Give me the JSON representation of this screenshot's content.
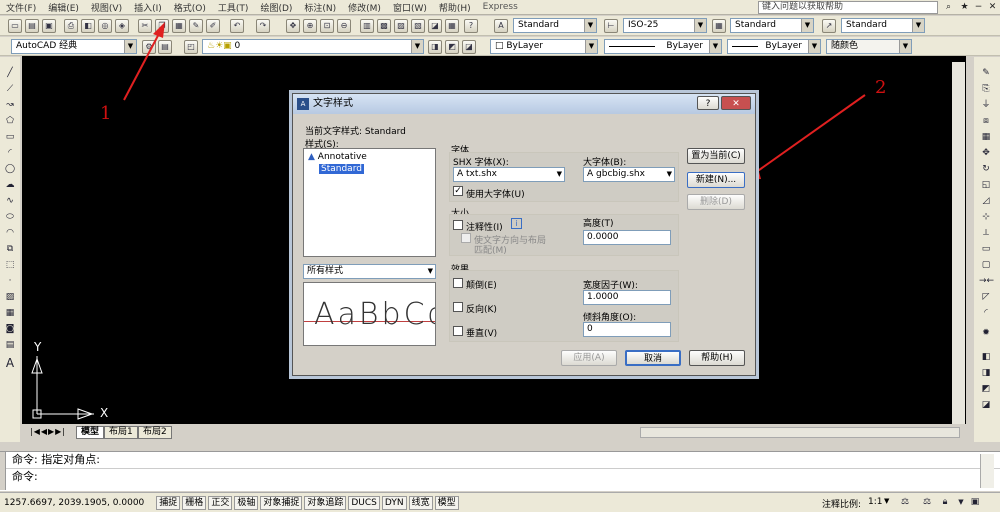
{
  "menu": [
    "文件(F)",
    "编辑(E)",
    "视图(V)",
    "插入(I)",
    "格式(O)",
    "工具(T)",
    "绘图(D)",
    "标注(N)",
    "修改(M)",
    "窗口(W)",
    "帮助(H)",
    "Express"
  ],
  "help_search": {
    "placeholder": "键入问题以获取帮助"
  },
  "toolbar2": {
    "text_style": "Standard",
    "dim_style": "ISO-25",
    "table_style": "Standard",
    "mleader_style": "Standard"
  },
  "toolbar3": {
    "workspace": "AutoCAD 经典",
    "layer": "0",
    "color": "ByLayer",
    "linetype": "ByLayer",
    "lineweight": "ByLayer",
    "plotstyle": "随颜色"
  },
  "annotations": {
    "arrow1": "1",
    "arrow2": "2"
  },
  "ucs": {
    "y": "Y",
    "x": "X"
  },
  "layout_tabs": [
    "模型",
    "布局1",
    "布局2"
  ],
  "command": {
    "line1": "命令: 指定对角点:",
    "line2": "命令:"
  },
  "status": {
    "coords": "1257.6697, 2039.1905, 0.0000",
    "toggles": [
      "捕捉",
      "栅格",
      "正交",
      "极轴",
      "对象捕捉",
      "对象追踪",
      "DUCS",
      "DYN",
      "线宽",
      "模型"
    ],
    "annotation_scale_label": "注释比例:",
    "annotation_scale": "1:1"
  },
  "dialog": {
    "title": "文字样式",
    "current_style_label": "当前文字样式: Standard",
    "styles_label": "样式(S):",
    "styles": [
      "Annotative",
      "Standard"
    ],
    "selected_style": "Standard",
    "filter_value": "所有样式",
    "preview_text": "AaBbCc",
    "font_group": "字体",
    "shx_font_label": "SHX 字体(X):",
    "shx_font_value": "txt.shx",
    "big_font_label": "大字体(B):",
    "big_font_value": "gbcbig.shx",
    "use_big_font_label": "使用大字体(U)",
    "size_group": "大小",
    "annotative_label": "注释性(I)",
    "info_icon_label": "i",
    "match_orientation_label": "使文字方向与布局",
    "match_orientation_label2": "匹配(M)",
    "height_label": "高度(T)",
    "height_value": "0.0000",
    "effects_group": "效果",
    "upside_down_label": "颠倒(E)",
    "backwards_label": "反向(K)",
    "vertical_label": "垂直(V)",
    "width_factor_label": "宽度因子(W):",
    "width_factor_value": "1.0000",
    "oblique_label": "倾斜角度(O):",
    "oblique_value": "0",
    "set_current_button": "置为当前(C)",
    "new_button": "新建(N)...",
    "delete_button": "删除(D)",
    "apply_button": "应用(A)",
    "cancel_button": "取消",
    "help_button": "帮助(H)",
    "help_title_button": "?",
    "close_button": "✕"
  }
}
